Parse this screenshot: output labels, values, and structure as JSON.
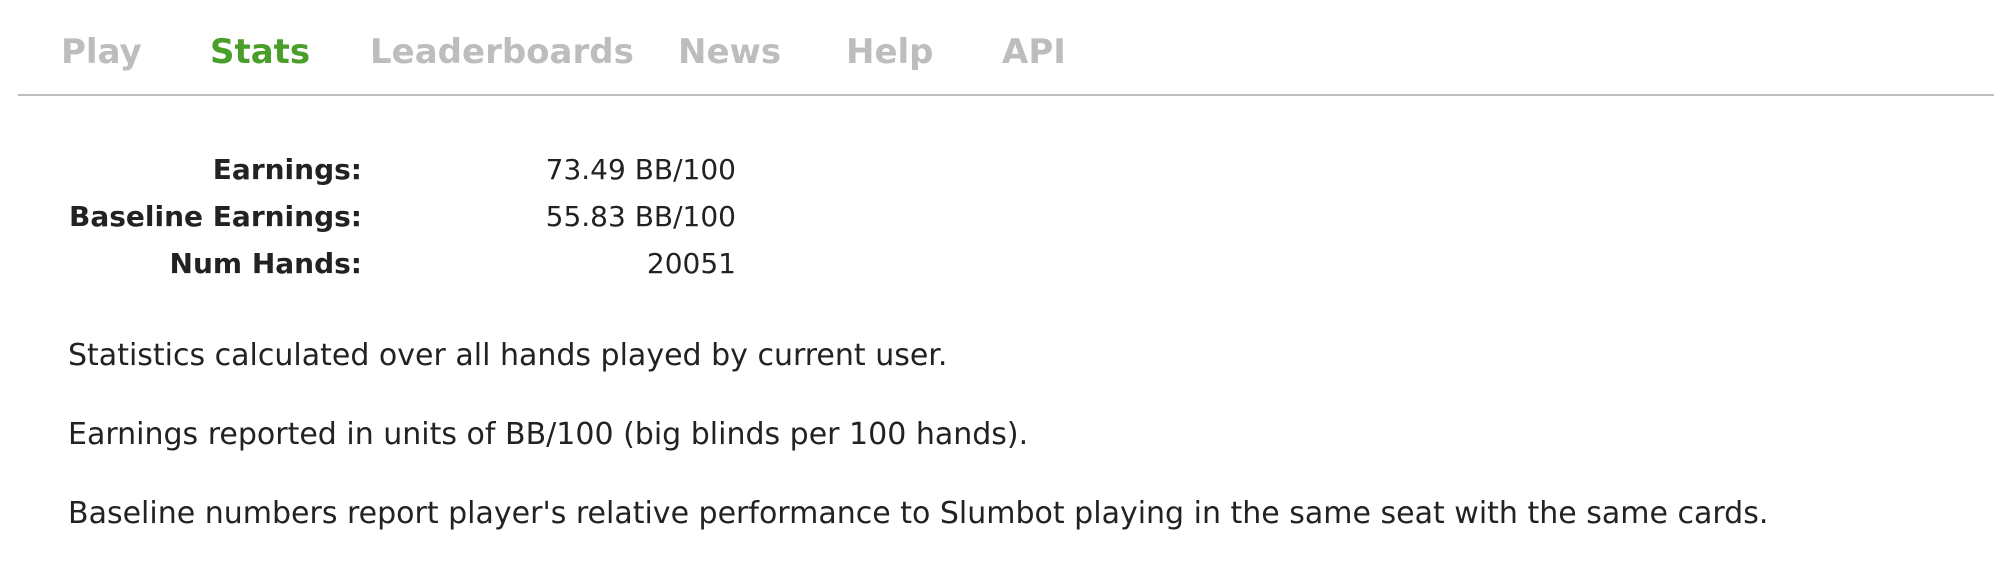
{
  "nav": {
    "items": [
      {
        "label": "Play",
        "active": false
      },
      {
        "label": "Stats",
        "active": true
      },
      {
        "label": "Leaderboards",
        "active": false
      },
      {
        "label": "News",
        "active": false
      },
      {
        "label": "Help",
        "active": false
      },
      {
        "label": "API",
        "active": false
      }
    ],
    "active_color": "#4a9e2a",
    "inactive_color": "#bdbdbd"
  },
  "stats": {
    "rows": [
      {
        "label": "Earnings:",
        "value": "73.49 BB/100"
      },
      {
        "label": "Baseline Earnings:",
        "value": "55.83 BB/100"
      },
      {
        "label": "Num Hands:",
        "value": "20051"
      }
    ]
  },
  "notes": [
    "Statistics calculated over all hands played by current user.",
    "Earnings reported in units of BB/100 (big blinds per 100 hands).",
    "Baseline numbers report player's relative performance to Slumbot playing in the same seat with the same cards."
  ]
}
